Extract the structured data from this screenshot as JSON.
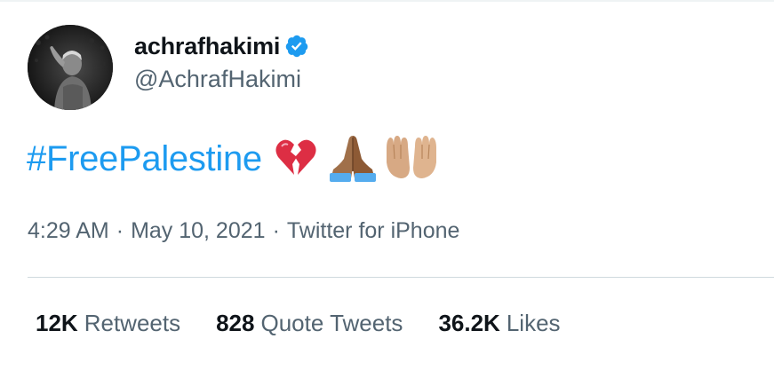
{
  "author": {
    "display_name": "achrafhakimi",
    "handle": "@AchrafHakimi",
    "verified": true
  },
  "tweet": {
    "hashtag": "#FreePalestine",
    "emojis": [
      "broken-heart-icon",
      "folded-hands-medium-dark-icon",
      "palms-up-together-medium-light-icon"
    ]
  },
  "meta": {
    "time": "4:29 AM",
    "separator": "·",
    "date": "May 10, 2021",
    "source": "Twitter for iPhone"
  },
  "stats": [
    {
      "value": "12K",
      "label": "Retweets"
    },
    {
      "value": "828",
      "label": "Quote Tweets"
    },
    {
      "value": "36.2K",
      "label": "Likes"
    }
  ],
  "colors": {
    "link": "#1d9bf0",
    "secondary_text": "#536471",
    "primary_text": "#0f1419",
    "verified": "#1d9bf0",
    "divider": "#cfd9de"
  }
}
